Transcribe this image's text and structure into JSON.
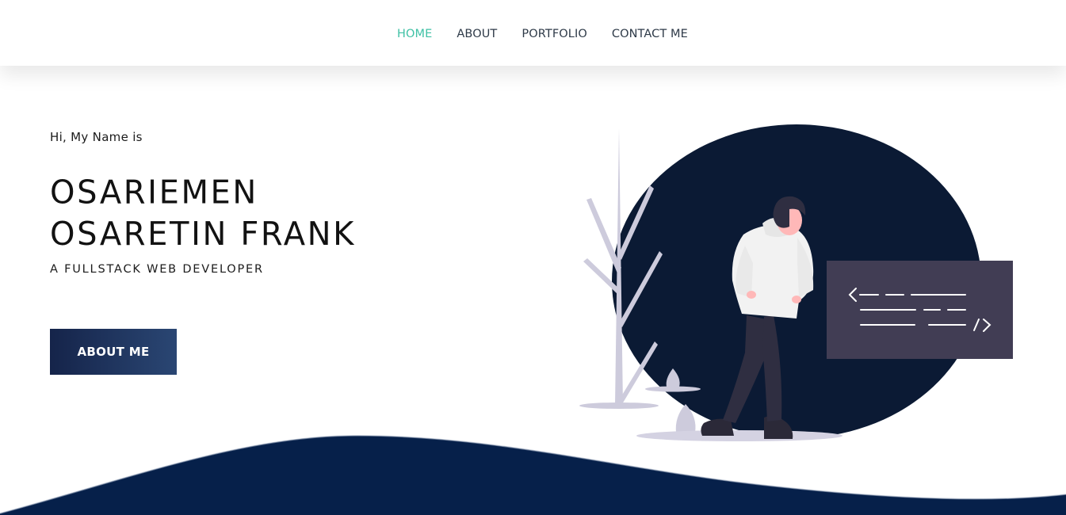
{
  "nav": {
    "items": [
      {
        "label": "HOME",
        "active": true
      },
      {
        "label": "ABOUT",
        "active": false
      },
      {
        "label": "PORTFOLIO",
        "active": false
      },
      {
        "label": "CONTACT ME",
        "active": false
      }
    ]
  },
  "hero": {
    "greeting": "Hi, My Name is",
    "name_line1": "OSARIEMEN",
    "name_line2": "OSARETIN FRANK",
    "subtitle": "A FULLSTACK WEB DEVELOPER",
    "cta_label": "ABOUT ME"
  },
  "illustration": {
    "code_symbol_open": "<",
    "code_symbol_close": "/>"
  },
  "colors": {
    "accent": "#3fc1a5",
    "navy": "#06204a",
    "circle": "#0b1a34",
    "code_panel": "#413d54"
  }
}
